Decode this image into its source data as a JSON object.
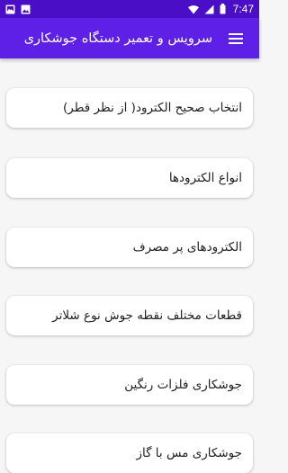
{
  "status_bar": {
    "time": "7:47",
    "icons": [
      "image-icon",
      "photo-icon",
      "wifi-icon",
      "signal-icon",
      "battery-icon"
    ]
  },
  "app_bar": {
    "title": "سرویس و تعمیر دستگاه جوشکاری",
    "menu_icon": "hamburger-menu-icon"
  },
  "items": [
    {
      "label": "انتخاب صحیح الکترود( از نظر قطر)"
    },
    {
      "label": "انواع الکترودها"
    },
    {
      "label": "الکترودهای پر مصرف"
    },
    {
      "label": "قطعات مختلف نقطه جوش نوع شلاتر"
    },
    {
      "label": "جوشکاری فلزات رنگین"
    },
    {
      "label": "جوشکاری مس با گاز"
    }
  ],
  "colors": {
    "status_bar": "#4a0ec6",
    "app_bar": "#5e1fe6",
    "background": "#f6f6f6",
    "card": "#ffffff"
  }
}
